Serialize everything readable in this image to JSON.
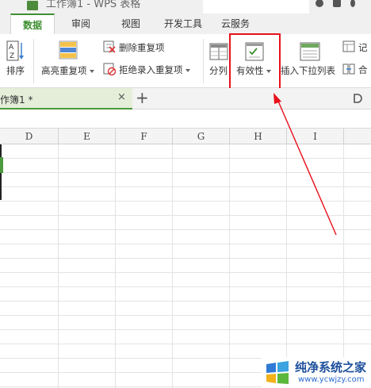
{
  "titlebar": {
    "title": "工作簿1 - WPS 表格"
  },
  "tabs": [
    {
      "label": "数据",
      "active": true
    },
    {
      "label": "审阅",
      "active": false
    },
    {
      "label": "视图",
      "active": false
    },
    {
      "label": "开发工具",
      "active": false
    },
    {
      "label": "云服务",
      "active": false
    }
  ],
  "ribbon": {
    "sort_label": "排序",
    "highlight_dup_label": "高亮重复项",
    "delete_dup_label": "删除重复项",
    "reject_dup_label": "拒绝录入重复项",
    "split_label": "分列",
    "validity_label": "有效性",
    "insert_dropdown_label": "插入下拉列表",
    "record_label": "记",
    "merge_label": "合"
  },
  "doc_tab": {
    "label": "作簿1 *",
    "close_symbol": "×",
    "new_tab_symbol": "+"
  },
  "grid": {
    "columns": [
      "D",
      "E",
      "F",
      "G",
      "H",
      "I"
    ]
  },
  "watermark": {
    "text": "纯净系统之家",
    "url": "www.ycwjzy.com"
  },
  "colors": {
    "accent_green": "#3e8f31",
    "highlight_red": "#e8101a",
    "watermark_blue": "#1d4f9c"
  }
}
